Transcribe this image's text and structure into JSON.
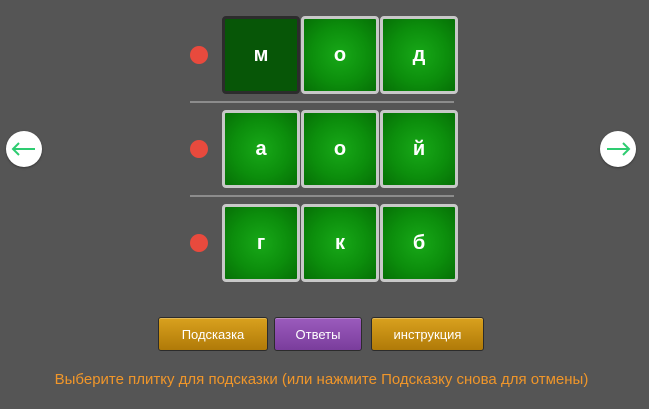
{
  "navigation": {
    "prev_icon": "arrow-left-icon",
    "next_icon": "arrow-right-icon",
    "arrow_color": "#2ecc71"
  },
  "board": {
    "rows": [
      {
        "status": "incorrect",
        "status_color": "#e84a3d",
        "tiles": [
          "м",
          "о",
          "д"
        ],
        "selected_tile": 0
      },
      {
        "status": "incorrect",
        "status_color": "#e84a3d",
        "tiles": [
          "а",
          "о",
          "й"
        ],
        "selected_tile": null
      },
      {
        "status": "incorrect",
        "status_color": "#e84a3d",
        "tiles": [
          "г",
          "к",
          "б"
        ],
        "selected_tile": null
      }
    ],
    "tile_color": "#0c8e0c",
    "selected_tile_color": "#075607"
  },
  "buttons": {
    "hint": "Подсказка",
    "answers": "Ответы",
    "instructions": "инструкция"
  },
  "message": "Выберите плитку для подсказки (или нажмите Подсказку снова для отмены)"
}
